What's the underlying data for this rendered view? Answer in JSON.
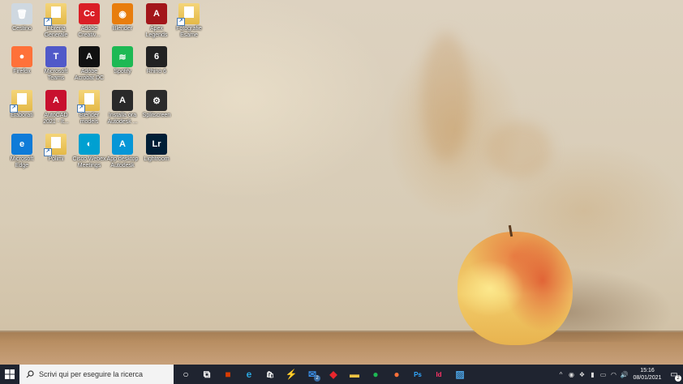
{
  "desktop_icons": [
    {
      "label": "Cestino",
      "icon": "recycle-bin-icon",
      "shortcut": false,
      "glyph": "🗑"
    },
    {
      "label": "Libreria\nGenerale",
      "icon": "folder-icon",
      "shortcut": true,
      "glyph": ""
    },
    {
      "label": "Adobe\nCreativ...",
      "icon": "adobe-creative-cloud-icon",
      "shortcut": true,
      "glyph": "Cc"
    },
    {
      "label": "Blender",
      "icon": "blender-icon",
      "shortcut": true,
      "glyph": "◉"
    },
    {
      "label": "Apex\nLegends",
      "icon": "apex-legends-icon",
      "shortcut": true,
      "glyph": "A"
    },
    {
      "label": "Fotografie\nEsame",
      "icon": "folder-icon",
      "shortcut": true,
      "glyph": ""
    },
    {
      "label": "Firefox",
      "icon": "firefox-icon",
      "shortcut": true,
      "glyph": "●"
    },
    {
      "label": "Microsoft\nTeams",
      "icon": "teams-icon",
      "shortcut": true,
      "glyph": "T"
    },
    {
      "label": "Adobe\nAcrobat DC",
      "icon": "acrobat-icon",
      "shortcut": true,
      "glyph": "A"
    },
    {
      "label": "Spotify",
      "icon": "spotify-icon",
      "shortcut": true,
      "glyph": "≋"
    },
    {
      "label": "Rhino 6",
      "icon": "rhino-icon",
      "shortcut": true,
      "glyph": "6"
    },
    {
      "label": "Elaborati",
      "icon": "folder-icon",
      "shortcut": true,
      "glyph": ""
    },
    {
      "label": "AutoCAD\n2021 - It...",
      "icon": "autocad-icon",
      "shortcut": true,
      "glyph": "A"
    },
    {
      "label": "Blender\nmodels",
      "icon": "folder-icon",
      "shortcut": true,
      "glyph": ""
    },
    {
      "label": "Installa ora\nAutodesk ...",
      "icon": "autodesk-install-icon",
      "shortcut": true,
      "glyph": "A"
    },
    {
      "label": "Splitscreen",
      "icon": "splitscreen-icon",
      "shortcut": true,
      "glyph": "⚙"
    },
    {
      "label": "Microsoft\nEdge",
      "icon": "edge-icon",
      "shortcut": true,
      "glyph": "e"
    },
    {
      "label": "Polimi",
      "icon": "folder-icon",
      "shortcut": true,
      "glyph": ""
    },
    {
      "label": "Cisco Webex\nMeetings",
      "icon": "webex-icon",
      "shortcut": true,
      "glyph": "◐"
    },
    {
      "label": "App desktop\nAutodesk",
      "icon": "autodesk-app-icon",
      "shortcut": true,
      "glyph": "A"
    },
    {
      "label": "Lightroom",
      "icon": "lightroom-icon",
      "shortcut": true,
      "glyph": "Lr"
    }
  ],
  "colors": {
    "recycle-bin-icon": "#cfd8e0",
    "folder-icon": "#e8bf55",
    "adobe-creative-cloud-icon": "#da1f26",
    "blender-icon": "#e87d0d",
    "apex-legends-icon": "#a3161a",
    "firefox-icon": "#ff7139",
    "teams-icon": "#5059c9",
    "acrobat-icon": "#111111",
    "spotify-icon": "#1db954",
    "rhino-icon": "#222222",
    "autocad-icon": "#c8102e",
    "autodesk-install-icon": "#2a2a2a",
    "splitscreen-icon": "#2b2b2b",
    "edge-icon": "#0f7bd8",
    "webex-icon": "#00a0d1",
    "autodesk-app-icon": "#0696d7",
    "lightroom-icon": "#001e36"
  },
  "taskbar": {
    "search_placeholder": "Scrivi qui per eseguire la ricerca",
    "pinned": [
      {
        "icon": "cortana-icon",
        "glyph": "○",
        "color": "#ffffff"
      },
      {
        "icon": "task-view-icon",
        "glyph": "⧉",
        "color": "#ffffff"
      },
      {
        "icon": "office-icon",
        "glyph": "■",
        "color": "#d83b01"
      },
      {
        "icon": "edge-icon",
        "glyph": "e",
        "color": "#2aa7e0"
      },
      {
        "icon": "store-icon",
        "glyph": "🛍",
        "color": "#ffffff"
      },
      {
        "icon": "power-automate-icon",
        "glyph": "⚡",
        "color": "#ffffff"
      },
      {
        "icon": "mail-icon",
        "glyph": "✉",
        "color": "#3a8ee6",
        "badge": "2"
      },
      {
        "icon": "app-red-diamond-icon",
        "glyph": "◆",
        "color": "#e8262d"
      },
      {
        "icon": "file-explorer-icon",
        "glyph": "▬",
        "color": "#f2c443"
      },
      {
        "icon": "spotify-icon",
        "glyph": "●",
        "color": "#1db954"
      },
      {
        "icon": "firefox-icon",
        "glyph": "●",
        "color": "#ff7139"
      },
      {
        "icon": "photoshop-icon",
        "glyph": "Ps",
        "color": "#31a8ff"
      },
      {
        "icon": "indesign-icon",
        "glyph": "Id",
        "color": "#ff3366"
      },
      {
        "icon": "photos-icon",
        "glyph": "▨",
        "color": "#4aa0e0"
      }
    ],
    "tray": [
      {
        "icon": "chevron-up-icon",
        "glyph": "^"
      },
      {
        "icon": "record-icon",
        "glyph": "◉"
      },
      {
        "icon": "dropbox-icon",
        "glyph": "❖"
      },
      {
        "icon": "usb-icon",
        "glyph": "▮"
      },
      {
        "icon": "battery-icon",
        "glyph": "▭"
      },
      {
        "icon": "network-icon",
        "glyph": "◠"
      },
      {
        "icon": "volume-icon",
        "glyph": "🔊"
      }
    ],
    "time": "15:16",
    "date": "08/01/2021",
    "notification_count": "2"
  }
}
